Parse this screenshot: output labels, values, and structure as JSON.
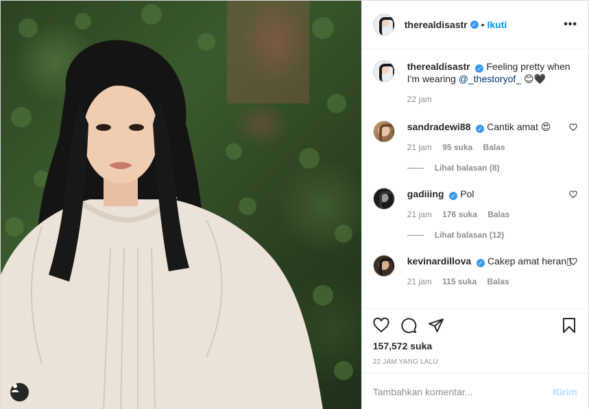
{
  "post": {
    "username": "therealdisastr",
    "follow_label": "Ikuti",
    "more_label": "•••",
    "caption_text": "Feeling pretty when I'm wearing ",
    "caption_mention": "@_thestoryof_",
    "caption_emoji": " 😊🖤",
    "caption_time": "22 jam"
  },
  "comments": [
    {
      "username": "sandradewi88",
      "text": "Cantik amat 😍",
      "time": "21 jam",
      "likes": "95 suka",
      "reply": "Balas",
      "view_replies": "Lihat balasan (8)"
    },
    {
      "username": "gadiiing",
      "text": "Pol",
      "time": "21 jam",
      "likes": "176 suka",
      "reply": "Balas",
      "view_replies": "Lihat balasan (12)"
    },
    {
      "username": "kevinardillova",
      "text": "Cakep amat heran▯",
      "time": "21 jam",
      "likes": "115 suka",
      "reply": "Balas"
    }
  ],
  "actions": {
    "likes": "157,572 suka",
    "timestamp": "22 JAM YANG LALU"
  },
  "composer": {
    "placeholder": "Tambahkan komentar...",
    "post_label": "Kirim"
  },
  "icons": [
    "heart-icon",
    "comment-icon",
    "share-icon",
    "bookmark-icon",
    "user-tag-icon",
    "verified-icon",
    "more-icon"
  ],
  "colors": {
    "link": "#0095f6",
    "verified": "#3897f0",
    "muted": "#8e8e8e",
    "post_button": "#b2dffc"
  }
}
